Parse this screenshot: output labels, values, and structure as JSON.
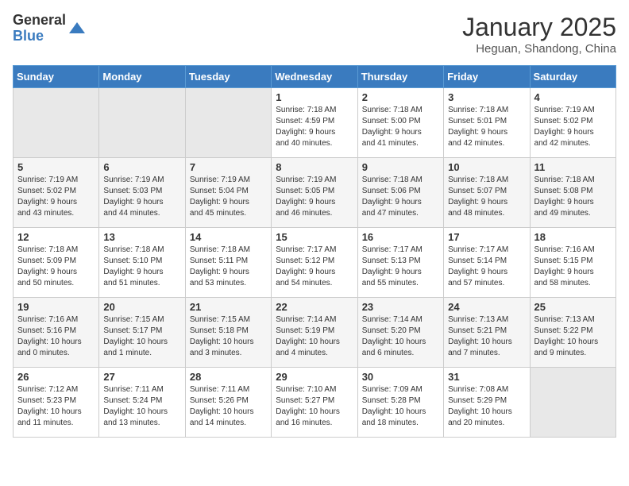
{
  "header": {
    "logo_general": "General",
    "logo_blue": "Blue",
    "title": "January 2025",
    "subtitle": "Heguan, Shandong, China"
  },
  "days_of_week": [
    "Sunday",
    "Monday",
    "Tuesday",
    "Wednesday",
    "Thursday",
    "Friday",
    "Saturday"
  ],
  "weeks": [
    [
      {
        "day": "",
        "info": ""
      },
      {
        "day": "",
        "info": ""
      },
      {
        "day": "",
        "info": ""
      },
      {
        "day": "1",
        "info": "Sunrise: 7:18 AM\nSunset: 4:59 PM\nDaylight: 9 hours\nand 40 minutes."
      },
      {
        "day": "2",
        "info": "Sunrise: 7:18 AM\nSunset: 5:00 PM\nDaylight: 9 hours\nand 41 minutes."
      },
      {
        "day": "3",
        "info": "Sunrise: 7:18 AM\nSunset: 5:01 PM\nDaylight: 9 hours\nand 42 minutes."
      },
      {
        "day": "4",
        "info": "Sunrise: 7:19 AM\nSunset: 5:02 PM\nDaylight: 9 hours\nand 42 minutes."
      }
    ],
    [
      {
        "day": "5",
        "info": "Sunrise: 7:19 AM\nSunset: 5:02 PM\nDaylight: 9 hours\nand 43 minutes."
      },
      {
        "day": "6",
        "info": "Sunrise: 7:19 AM\nSunset: 5:03 PM\nDaylight: 9 hours\nand 44 minutes."
      },
      {
        "day": "7",
        "info": "Sunrise: 7:19 AM\nSunset: 5:04 PM\nDaylight: 9 hours\nand 45 minutes."
      },
      {
        "day": "8",
        "info": "Sunrise: 7:19 AM\nSunset: 5:05 PM\nDaylight: 9 hours\nand 46 minutes."
      },
      {
        "day": "9",
        "info": "Sunrise: 7:18 AM\nSunset: 5:06 PM\nDaylight: 9 hours\nand 47 minutes."
      },
      {
        "day": "10",
        "info": "Sunrise: 7:18 AM\nSunset: 5:07 PM\nDaylight: 9 hours\nand 48 minutes."
      },
      {
        "day": "11",
        "info": "Sunrise: 7:18 AM\nSunset: 5:08 PM\nDaylight: 9 hours\nand 49 minutes."
      }
    ],
    [
      {
        "day": "12",
        "info": "Sunrise: 7:18 AM\nSunset: 5:09 PM\nDaylight: 9 hours\nand 50 minutes."
      },
      {
        "day": "13",
        "info": "Sunrise: 7:18 AM\nSunset: 5:10 PM\nDaylight: 9 hours\nand 51 minutes."
      },
      {
        "day": "14",
        "info": "Sunrise: 7:18 AM\nSunset: 5:11 PM\nDaylight: 9 hours\nand 53 minutes."
      },
      {
        "day": "15",
        "info": "Sunrise: 7:17 AM\nSunset: 5:12 PM\nDaylight: 9 hours\nand 54 minutes."
      },
      {
        "day": "16",
        "info": "Sunrise: 7:17 AM\nSunset: 5:13 PM\nDaylight: 9 hours\nand 55 minutes."
      },
      {
        "day": "17",
        "info": "Sunrise: 7:17 AM\nSunset: 5:14 PM\nDaylight: 9 hours\nand 57 minutes."
      },
      {
        "day": "18",
        "info": "Sunrise: 7:16 AM\nSunset: 5:15 PM\nDaylight: 9 hours\nand 58 minutes."
      }
    ],
    [
      {
        "day": "19",
        "info": "Sunrise: 7:16 AM\nSunset: 5:16 PM\nDaylight: 10 hours\nand 0 minutes."
      },
      {
        "day": "20",
        "info": "Sunrise: 7:15 AM\nSunset: 5:17 PM\nDaylight: 10 hours\nand 1 minute."
      },
      {
        "day": "21",
        "info": "Sunrise: 7:15 AM\nSunset: 5:18 PM\nDaylight: 10 hours\nand 3 minutes."
      },
      {
        "day": "22",
        "info": "Sunrise: 7:14 AM\nSunset: 5:19 PM\nDaylight: 10 hours\nand 4 minutes."
      },
      {
        "day": "23",
        "info": "Sunrise: 7:14 AM\nSunset: 5:20 PM\nDaylight: 10 hours\nand 6 minutes."
      },
      {
        "day": "24",
        "info": "Sunrise: 7:13 AM\nSunset: 5:21 PM\nDaylight: 10 hours\nand 7 minutes."
      },
      {
        "day": "25",
        "info": "Sunrise: 7:13 AM\nSunset: 5:22 PM\nDaylight: 10 hours\nand 9 minutes."
      }
    ],
    [
      {
        "day": "26",
        "info": "Sunrise: 7:12 AM\nSunset: 5:23 PM\nDaylight: 10 hours\nand 11 minutes."
      },
      {
        "day": "27",
        "info": "Sunrise: 7:11 AM\nSunset: 5:24 PM\nDaylight: 10 hours\nand 13 minutes."
      },
      {
        "day": "28",
        "info": "Sunrise: 7:11 AM\nSunset: 5:26 PM\nDaylight: 10 hours\nand 14 minutes."
      },
      {
        "day": "29",
        "info": "Sunrise: 7:10 AM\nSunset: 5:27 PM\nDaylight: 10 hours\nand 16 minutes."
      },
      {
        "day": "30",
        "info": "Sunrise: 7:09 AM\nSunset: 5:28 PM\nDaylight: 10 hours\nand 18 minutes."
      },
      {
        "day": "31",
        "info": "Sunrise: 7:08 AM\nSunset: 5:29 PM\nDaylight: 10 hours\nand 20 minutes."
      },
      {
        "day": "",
        "info": ""
      }
    ]
  ]
}
